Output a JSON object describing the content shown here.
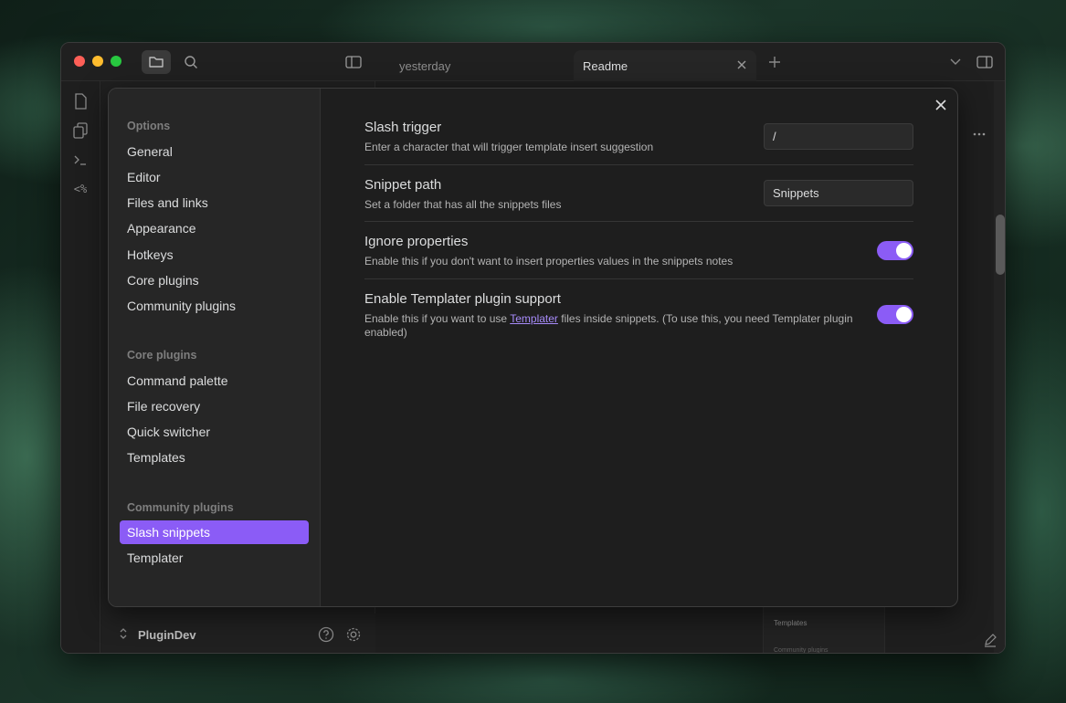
{
  "titlebar": {
    "tabs": [
      {
        "label": "yesterday"
      },
      {
        "label": "Readme"
      }
    ]
  },
  "ribbon": {
    "templater_glyph": "<%"
  },
  "vault": {
    "name": "PluginDev"
  },
  "background_hint": {
    "templates": "Templates",
    "community": "Community plugins"
  },
  "settings_nav": {
    "options_header": "Options",
    "options": [
      "General",
      "Editor",
      "Files and links",
      "Appearance",
      "Hotkeys",
      "Core plugins",
      "Community plugins"
    ],
    "core_header": "Core plugins",
    "core": [
      "Command palette",
      "File recovery",
      "Quick switcher",
      "Templates"
    ],
    "community_header": "Community plugins",
    "community": [
      "Slash snippets",
      "Templater"
    ],
    "active": "Slash snippets"
  },
  "settings": {
    "slash_trigger": {
      "name": "Slash trigger",
      "desc": "Enter a character that will trigger template insert suggestion",
      "value": "/"
    },
    "snippet_path": {
      "name": "Snippet path",
      "desc": "Set a folder that has all the snippets files",
      "value": "Snippets"
    },
    "ignore_properties": {
      "name": "Ignore properties",
      "desc": "Enable this if you don't want to insert properties values in the snippets notes",
      "enabled": true
    },
    "templater_support": {
      "name": "Enable Templater plugin support",
      "desc_before": "Enable this if you want to use ",
      "desc_link": "Templater",
      "desc_after": " files inside snippets. (To use this, you need Templater plugin enabled)",
      "enabled": true
    }
  },
  "colors": {
    "accent": "#8b5cf6",
    "link": "#a78bfa"
  }
}
